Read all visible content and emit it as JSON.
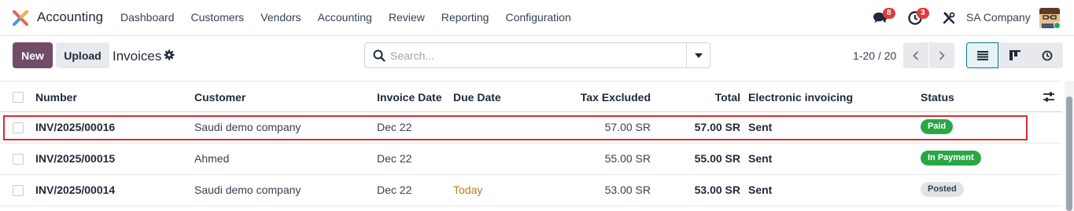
{
  "navbar": {
    "app_name": "Accounting",
    "menu": [
      "Dashboard",
      "Customers",
      "Vendors",
      "Accounting",
      "Review",
      "Reporting",
      "Configuration"
    ],
    "messages_count": "8",
    "activities_count": "3",
    "company": "SA Company"
  },
  "control": {
    "new_label": "New",
    "upload_label": "Upload",
    "title": "Invoices",
    "search_placeholder": "Search...",
    "pager": "1-20 / 20"
  },
  "table": {
    "headers": {
      "number": "Number",
      "customer": "Customer",
      "invoice_date": "Invoice Date",
      "due_date": "Due Date",
      "tax_excluded": "Tax Excluded",
      "total": "Total",
      "einvoicing": "Electronic invoicing",
      "status": "Status"
    },
    "rows": [
      {
        "number": "INV/2025/00016",
        "customer": "Saudi demo company",
        "invoice_date": "Dec 22",
        "due_date": "",
        "tax_excluded": "57.00 SR",
        "total": "57.00 SR",
        "einvoicing": "Sent",
        "status": "Paid"
      },
      {
        "number": "INV/2025/00015",
        "customer": "Ahmed",
        "invoice_date": "Dec 22",
        "due_date": "",
        "tax_excluded": "55.00 SR",
        "total": "55.00 SR",
        "einvoicing": "Sent",
        "status": "In Payment"
      },
      {
        "number": "INV/2025/00014",
        "customer": "Saudi demo company",
        "invoice_date": "Dec 22",
        "due_date": "Today",
        "tax_excluded": "53.00 SR",
        "total": "53.00 SR",
        "einvoicing": "Sent",
        "status": "Posted"
      }
    ]
  },
  "colors": {
    "brand": "#714b67",
    "accent": "#017e84",
    "paid": "#28a745",
    "posted": "#e0e2e6",
    "today": "#b7791f",
    "highlight": "#d92d2d"
  }
}
